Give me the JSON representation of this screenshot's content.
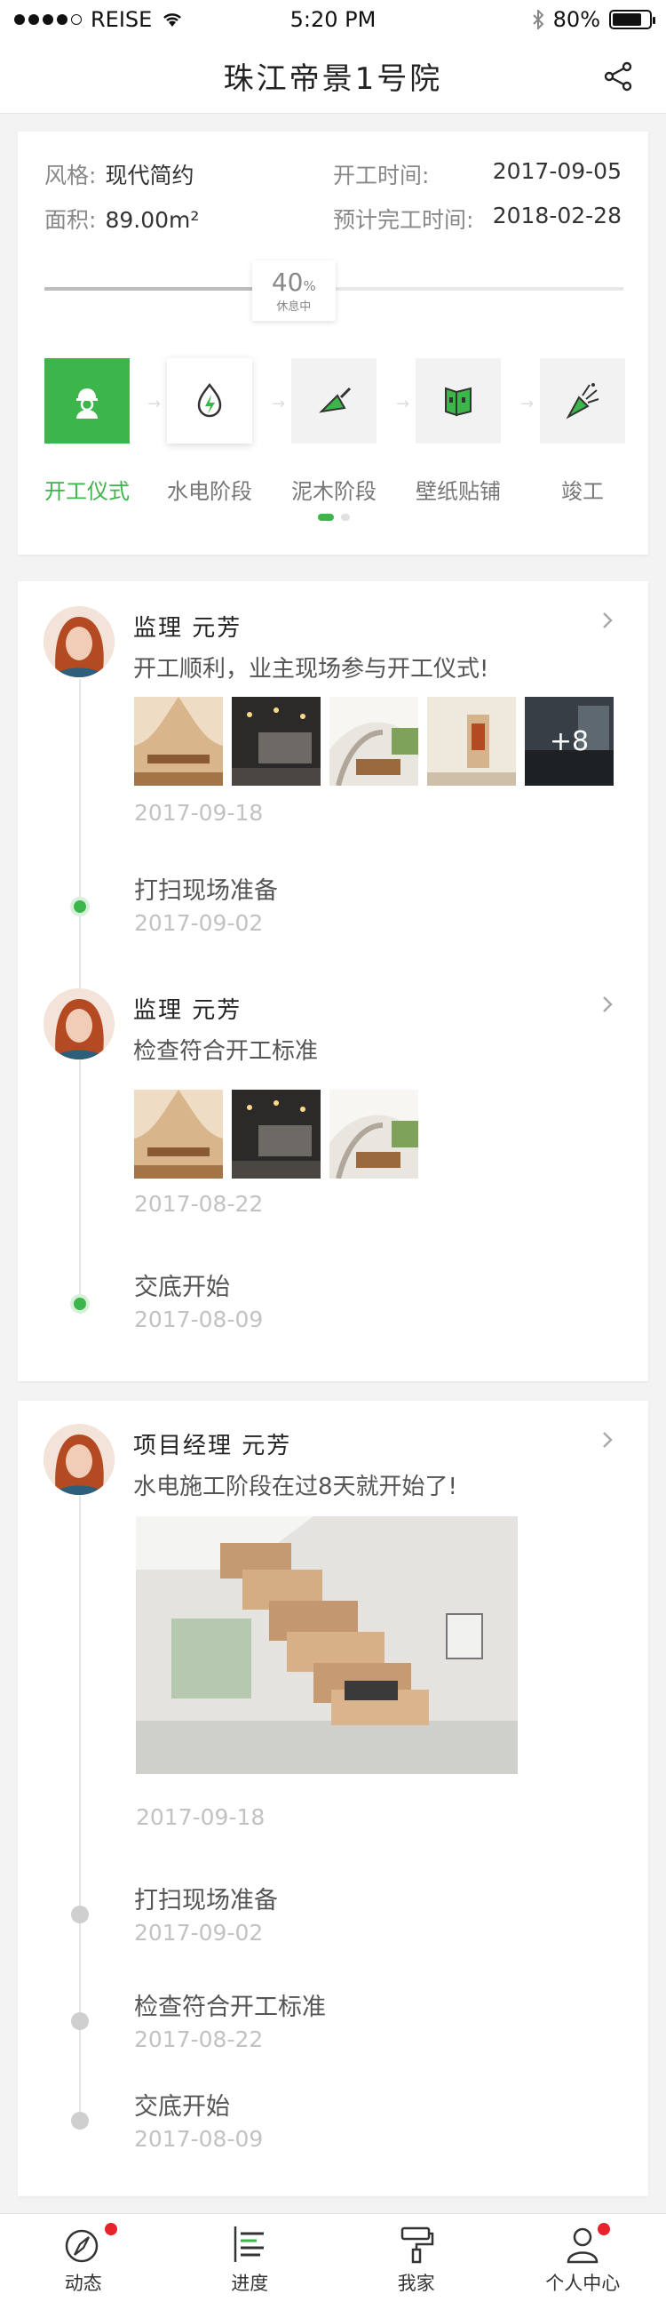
{
  "status_bar": {
    "carrier": "REISE",
    "time": "5:20 PM",
    "battery": "80%"
  },
  "nav": {
    "title": "珠江帝景1号院"
  },
  "project": {
    "style_label": "风格:",
    "style_value": "现代简约",
    "area_label": "面积:",
    "area_value": "89.00m²",
    "start_label": "开工时间:",
    "start_value": "2017-09-05",
    "finish_label": "预计完工时间:",
    "finish_value": "2018-02-28",
    "progress_value": "40",
    "progress_unit": "%",
    "progress_fraction": 0.4,
    "progress_status": "休息中"
  },
  "stages": [
    {
      "label": "开工仪式",
      "icon": "worker-helmet-icon",
      "state": "done"
    },
    {
      "label": "水电阶段",
      "icon": "water-electric-icon",
      "state": "current"
    },
    {
      "label": "泥木阶段",
      "icon": "trowel-icon",
      "state": "pending"
    },
    {
      "label": "壁纸贴铺",
      "icon": "wallpaper-icon",
      "state": "pending"
    },
    {
      "label": "竣工",
      "icon": "celebration-icon",
      "state": "pending"
    }
  ],
  "feed1": {
    "post1": {
      "author": "监理  元芳",
      "text": "开工顺利，业主现场参与开工仪式!",
      "more": "+8",
      "date": "2017-09-18"
    },
    "event1": {
      "title": "打扫现场准备",
      "date": "2017-09-02"
    },
    "post2": {
      "author": "监理  元芳",
      "text": "检查符合开工标准",
      "date": "2017-08-22"
    },
    "event2": {
      "title": "交底开始",
      "date": "2017-08-09"
    }
  },
  "feed2": {
    "post": {
      "author": "项目经理  元芳",
      "text": "水电施工阶段在过8天就开始了!",
      "date": "2017-09-18"
    },
    "events": [
      {
        "title": "打扫现场准备",
        "date": "2017-09-02"
      },
      {
        "title": "检查符合开工标准",
        "date": "2017-08-22"
      },
      {
        "title": "交底开始",
        "date": "2017-08-09"
      }
    ]
  },
  "tabs": [
    {
      "label": "动态",
      "icon": "compass-icon",
      "badge": true
    },
    {
      "label": "进度",
      "icon": "progress-list-icon",
      "badge": false
    },
    {
      "label": "我家",
      "icon": "paint-roller-icon",
      "badge": false
    },
    {
      "label": "个人中心",
      "icon": "person-icon",
      "badge": true
    }
  ],
  "colors": {
    "accent": "#3cb54a",
    "badge": "#e8222b"
  }
}
